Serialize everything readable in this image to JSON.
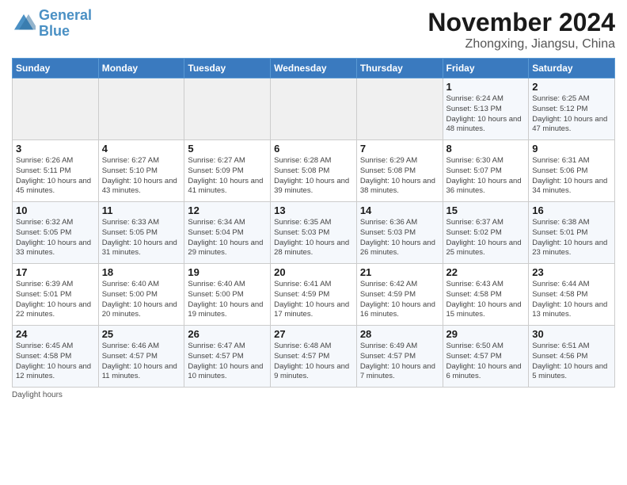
{
  "header": {
    "logo_line1": "General",
    "logo_line2": "Blue",
    "month": "November 2024",
    "location": "Zhongxing, Jiangsu, China"
  },
  "days_of_week": [
    "Sunday",
    "Monday",
    "Tuesday",
    "Wednesday",
    "Thursday",
    "Friday",
    "Saturday"
  ],
  "weeks": [
    [
      {
        "day": "",
        "info": ""
      },
      {
        "day": "",
        "info": ""
      },
      {
        "day": "",
        "info": ""
      },
      {
        "day": "",
        "info": ""
      },
      {
        "day": "",
        "info": ""
      },
      {
        "day": "1",
        "info": "Sunrise: 6:24 AM\nSunset: 5:13 PM\nDaylight: 10 hours\nand 48 minutes."
      },
      {
        "day": "2",
        "info": "Sunrise: 6:25 AM\nSunset: 5:12 PM\nDaylight: 10 hours\nand 47 minutes."
      }
    ],
    [
      {
        "day": "3",
        "info": "Sunrise: 6:26 AM\nSunset: 5:11 PM\nDaylight: 10 hours\nand 45 minutes."
      },
      {
        "day": "4",
        "info": "Sunrise: 6:27 AM\nSunset: 5:10 PM\nDaylight: 10 hours\nand 43 minutes."
      },
      {
        "day": "5",
        "info": "Sunrise: 6:27 AM\nSunset: 5:09 PM\nDaylight: 10 hours\nand 41 minutes."
      },
      {
        "day": "6",
        "info": "Sunrise: 6:28 AM\nSunset: 5:08 PM\nDaylight: 10 hours\nand 39 minutes."
      },
      {
        "day": "7",
        "info": "Sunrise: 6:29 AM\nSunset: 5:08 PM\nDaylight: 10 hours\nand 38 minutes."
      },
      {
        "day": "8",
        "info": "Sunrise: 6:30 AM\nSunset: 5:07 PM\nDaylight: 10 hours\nand 36 minutes."
      },
      {
        "day": "9",
        "info": "Sunrise: 6:31 AM\nSunset: 5:06 PM\nDaylight: 10 hours\nand 34 minutes."
      }
    ],
    [
      {
        "day": "10",
        "info": "Sunrise: 6:32 AM\nSunset: 5:05 PM\nDaylight: 10 hours\nand 33 minutes."
      },
      {
        "day": "11",
        "info": "Sunrise: 6:33 AM\nSunset: 5:05 PM\nDaylight: 10 hours\nand 31 minutes."
      },
      {
        "day": "12",
        "info": "Sunrise: 6:34 AM\nSunset: 5:04 PM\nDaylight: 10 hours\nand 29 minutes."
      },
      {
        "day": "13",
        "info": "Sunrise: 6:35 AM\nSunset: 5:03 PM\nDaylight: 10 hours\nand 28 minutes."
      },
      {
        "day": "14",
        "info": "Sunrise: 6:36 AM\nSunset: 5:03 PM\nDaylight: 10 hours\nand 26 minutes."
      },
      {
        "day": "15",
        "info": "Sunrise: 6:37 AM\nSunset: 5:02 PM\nDaylight: 10 hours\nand 25 minutes."
      },
      {
        "day": "16",
        "info": "Sunrise: 6:38 AM\nSunset: 5:01 PM\nDaylight: 10 hours\nand 23 minutes."
      }
    ],
    [
      {
        "day": "17",
        "info": "Sunrise: 6:39 AM\nSunset: 5:01 PM\nDaylight: 10 hours\nand 22 minutes."
      },
      {
        "day": "18",
        "info": "Sunrise: 6:40 AM\nSunset: 5:00 PM\nDaylight: 10 hours\nand 20 minutes."
      },
      {
        "day": "19",
        "info": "Sunrise: 6:40 AM\nSunset: 5:00 PM\nDaylight: 10 hours\nand 19 minutes."
      },
      {
        "day": "20",
        "info": "Sunrise: 6:41 AM\nSunset: 4:59 PM\nDaylight: 10 hours\nand 17 minutes."
      },
      {
        "day": "21",
        "info": "Sunrise: 6:42 AM\nSunset: 4:59 PM\nDaylight: 10 hours\nand 16 minutes."
      },
      {
        "day": "22",
        "info": "Sunrise: 6:43 AM\nSunset: 4:58 PM\nDaylight: 10 hours\nand 15 minutes."
      },
      {
        "day": "23",
        "info": "Sunrise: 6:44 AM\nSunset: 4:58 PM\nDaylight: 10 hours\nand 13 minutes."
      }
    ],
    [
      {
        "day": "24",
        "info": "Sunrise: 6:45 AM\nSunset: 4:58 PM\nDaylight: 10 hours\nand 12 minutes."
      },
      {
        "day": "25",
        "info": "Sunrise: 6:46 AM\nSunset: 4:57 PM\nDaylight: 10 hours\nand 11 minutes."
      },
      {
        "day": "26",
        "info": "Sunrise: 6:47 AM\nSunset: 4:57 PM\nDaylight: 10 hours\nand 10 minutes."
      },
      {
        "day": "27",
        "info": "Sunrise: 6:48 AM\nSunset: 4:57 PM\nDaylight: 10 hours\nand 9 minutes."
      },
      {
        "day": "28",
        "info": "Sunrise: 6:49 AM\nSunset: 4:57 PM\nDaylight: 10 hours\nand 7 minutes."
      },
      {
        "day": "29",
        "info": "Sunrise: 6:50 AM\nSunset: 4:57 PM\nDaylight: 10 hours\nand 6 minutes."
      },
      {
        "day": "30",
        "info": "Sunrise: 6:51 AM\nSunset: 4:56 PM\nDaylight: 10 hours\nand 5 minutes."
      }
    ]
  ],
  "footer": {
    "daylight_label": "Daylight hours"
  }
}
